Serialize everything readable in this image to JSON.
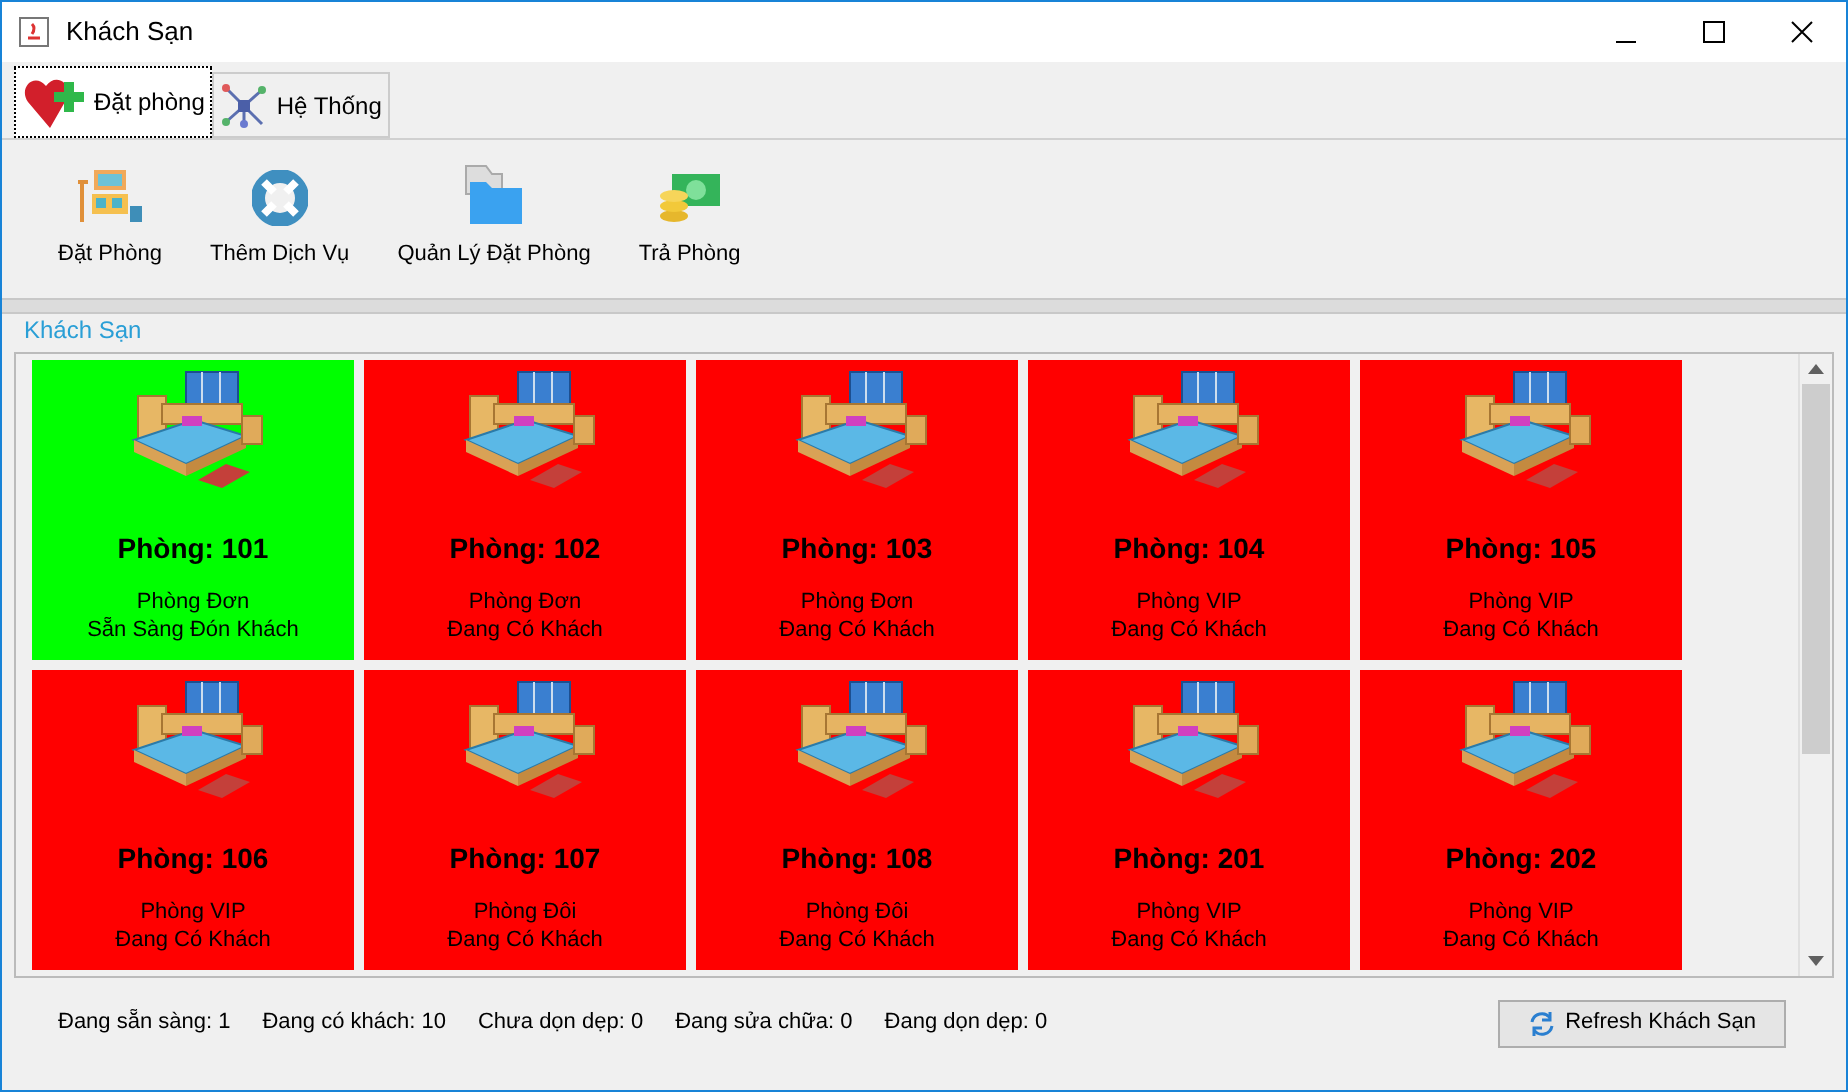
{
  "window": {
    "title": "Khách Sạn"
  },
  "tabs": [
    {
      "label": "Đặt phòng",
      "selected": true,
      "kind": "heart"
    },
    {
      "label": "Hệ Thống",
      "selected": false,
      "kind": "network"
    }
  ],
  "toolbar": [
    {
      "label": "Đặt Phòng",
      "kind": "room"
    },
    {
      "label": "Thêm Dịch Vụ",
      "kind": "lifebuoy"
    },
    {
      "label": "Quản Lý Đặt Phòng",
      "kind": "folder"
    },
    {
      "label": "Trả Phòng",
      "kind": "money"
    }
  ],
  "panel": {
    "title": "Khách Sạn",
    "rooms": [
      {
        "name": "Phòng: 101",
        "type": "Phòng Đơn",
        "status": "Sẵn Sàng Đón Khách",
        "color": "#00ff00"
      },
      {
        "name": "Phòng: 102",
        "type": "Phòng Đơn",
        "status": "Đang Có Khách",
        "color": "#ff0000"
      },
      {
        "name": "Phòng: 103",
        "type": "Phòng Đơn",
        "status": "Đang Có Khách",
        "color": "#ff0000"
      },
      {
        "name": "Phòng: 104",
        "type": "Phòng VIP",
        "status": "Đang Có Khách",
        "color": "#ff0000"
      },
      {
        "name": "Phòng: 105",
        "type": "Phòng VIP",
        "status": "Đang Có Khách",
        "color": "#ff0000"
      },
      {
        "name": "Phòng: 106",
        "type": "Phòng VIP",
        "status": "Đang Có Khách",
        "color": "#ff0000"
      },
      {
        "name": "Phòng: 107",
        "type": "Phòng Đôi",
        "status": "Đang Có Khách",
        "color": "#ff0000"
      },
      {
        "name": "Phòng: 108",
        "type": "Phòng Đôi",
        "status": "Đang Có Khách",
        "color": "#ff0000"
      },
      {
        "name": "Phòng: 201",
        "type": "Phòng VIP",
        "status": "Đang Có Khách",
        "color": "#ff0000"
      },
      {
        "name": "Phòng: 202",
        "type": "Phòng VIP",
        "status": "Đang Có Khách",
        "color": "#ff0000"
      }
    ]
  },
  "status_bar": {
    "counts": [
      "Đang sẵn sàng: 1",
      "Đang có khách: 10",
      "Chưa dọn dẹp: 0",
      "Đang sửa chữa: 0",
      "Đang dọn dẹp: 0"
    ],
    "button": "Refresh Khách Sạn"
  }
}
